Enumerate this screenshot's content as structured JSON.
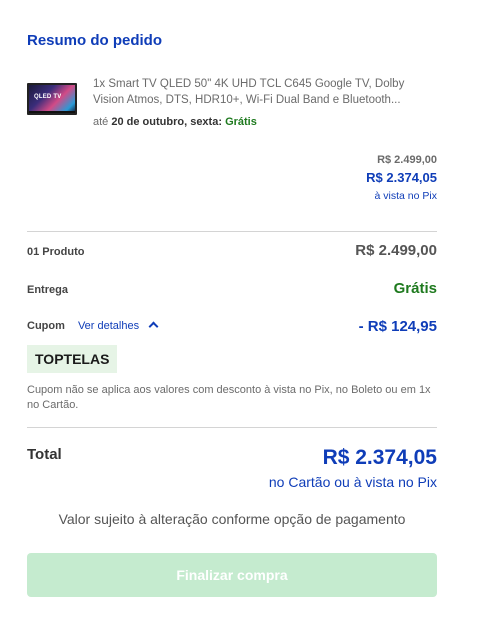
{
  "summary": {
    "title": "Resumo do pedido"
  },
  "product": {
    "name": "1x Smart TV QLED 50\" 4K UHD TCL C645 Google TV, Dolby Vision Atmos, DTS, HDR10+, Wi-Fi Dual Band e Bluetooth...",
    "delivery_prefix": "até",
    "delivery_date": "20 de outubro, sexta:",
    "delivery_cost": "Grátis",
    "thumbnail_text": "QLED TV"
  },
  "prices": {
    "original": "R$ 2.499,00",
    "discounted": "R$ 2.374,05",
    "discount_note": "à vista no Pix"
  },
  "breakdown": {
    "products_label": "01 Produto",
    "products_value": "R$ 2.499,00",
    "shipping_label": "Entrega",
    "shipping_value": "Grátis",
    "coupon_label": "Cupom",
    "coupon_details_link": "Ver detalhes",
    "coupon_value": "- R$ 124,95"
  },
  "coupon": {
    "code": "TOPTELAS",
    "note": "Cupom não se aplica aos valores com desconto à vista no Pix, no Boleto ou em 1x no Cartão."
  },
  "total": {
    "label": "Total",
    "value": "R$ 2.374,05",
    "note": "no Cartão ou à vista no Pix"
  },
  "disclaimer": "Valor sujeito à alteração conforme opção de pagamento",
  "actions": {
    "checkout_label": "Finalizar compra"
  },
  "colors": {
    "brand_blue": "#0f3db8",
    "success_green": "#1f7a1f",
    "disabled_button": "#c5ebcf"
  }
}
